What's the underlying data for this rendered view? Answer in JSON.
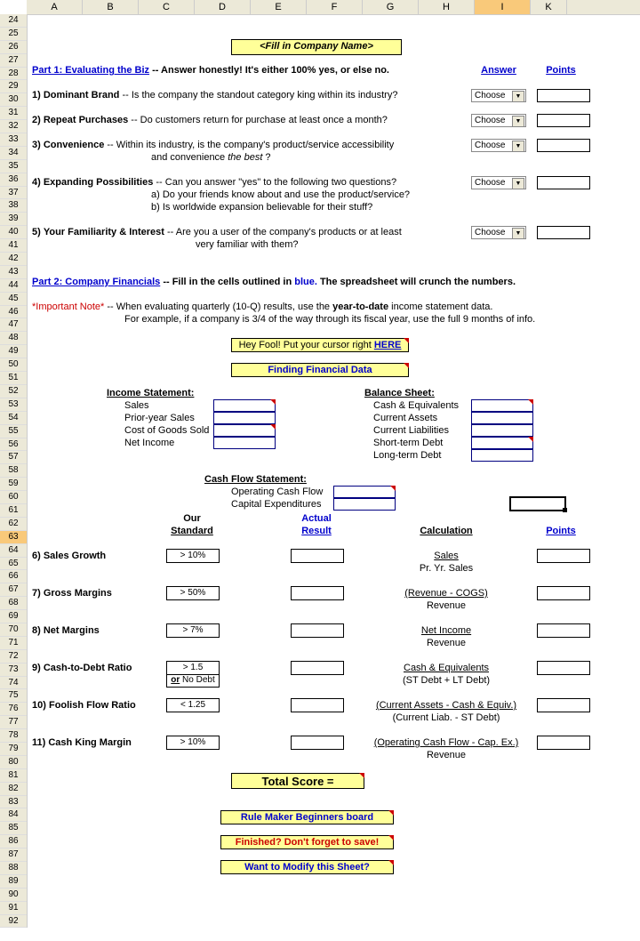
{
  "cols": [
    "A",
    "B",
    "C",
    "D",
    "E",
    "F",
    "G",
    "H",
    "I",
    "K"
  ],
  "selected_col": "I",
  "row_start": 24,
  "row_end": 92,
  "selected_row": 63,
  "title": "<Fill in Company Name>",
  "part1": {
    "heading": "Part 1:  Evaluating the Biz",
    "suffix": " -- Answer honestly!  It's either 100% yes, or else no.",
    "answer_hdr": "Answer",
    "points_hdr": "Points"
  },
  "q": [
    {
      "n": "1)",
      "label": "Dominant Brand",
      "text": " -- Is the company the standout category king within its industry?",
      "choose": "Choose"
    },
    {
      "n": "2)",
      "label": "Repeat Purchases",
      "text": " -- Do customers return for purchase at least once a month?",
      "choose": "Choose"
    },
    {
      "n": "3)",
      "label": "Convenience",
      "text": " -- Within its industry, is the company's product/service accessibility",
      "sub": "and convenience the best ?",
      "choose": "Choose"
    },
    {
      "n": "4)",
      "label": "Expanding Possibilities",
      "text": " -- Can you answer \"yes\" to the following two questions?",
      "sub1": "a) Do your friends know about and use the product/service?",
      "sub2": "b) Is worldwide expansion believable for their stuff?",
      "choose": "Choose"
    },
    {
      "n": "5)",
      "label": "Your Familiarity & Interest",
      "text": " -- Are you a user of the company's products or at least",
      "sub": "very familiar with them?",
      "choose": "Choose"
    }
  ],
  "part2": {
    "heading": "Part 2:  Company Financials",
    "suffix": " -- Fill in the cells outlined in ",
    "blue": "blue.",
    "suffix2": " The spreadsheet will crunch the numbers."
  },
  "note": {
    "star": "*Important Note*",
    "text1": " -- When evaluating quarterly (10-Q) results, use the ",
    "bold1": "year-to-date",
    "text2": " income statement data.",
    "line2": "For example, if a company is 3/4 of the way through its fiscal year, use the full 9 months of info."
  },
  "heyfool": {
    "pre": "Hey Fool!  Put your cursor right ",
    "here": "HERE"
  },
  "finding": "Finding Financial Data",
  "income": {
    "hdr": "Income Statement:",
    "rows": [
      "Sales",
      "Prior-year Sales",
      "Cost of Goods Sold",
      "Net Income"
    ]
  },
  "balance": {
    "hdr": "Balance Sheet:",
    "rows": [
      "Cash & Equivalents",
      "Current Assets",
      "Current Liabilities",
      "Short-term Debt",
      "Long-term Debt"
    ]
  },
  "cashflow": {
    "hdr": "Cash Flow Statement:",
    "rows": [
      "Operating Cash Flow",
      "Capital Expenditures"
    ]
  },
  "hdrs": {
    "our1": "Our",
    "our2": "Standard",
    "act1": "Actual",
    "act2": "Result",
    "calc": "Calculation",
    "pts": "Points"
  },
  "m": [
    {
      "n": "6)",
      "label": "Sales Growth",
      "std": "> 10%",
      "c1": "Sales",
      "c2": "Pr. Yr. Sales"
    },
    {
      "n": "7)",
      "label": "Gross Margins",
      "std": "> 50%",
      "c1": "(Revenue - COGS)",
      "c2": "Revenue"
    },
    {
      "n": "8)",
      "label": "Net Margins",
      "std": "> 7%",
      "c1": "Net Income",
      "c2": "Revenue"
    },
    {
      "n": "9)",
      "label": "Cash-to-Debt Ratio",
      "std": "> 1.5",
      "std2": "or No Debt",
      "c1": "Cash & Equivalents",
      "c2": "(ST Debt + LT Debt)"
    },
    {
      "n": "10)",
      "label": "Foolish Flow Ratio",
      "std": "< 1.25",
      "c1": "(Current Assets - Cash & Equiv.)",
      "c2": "(Current Liab. - ST Debt)"
    },
    {
      "n": "11)",
      "label": "Cash King Margin",
      "std": "> 10%",
      "c1": "(Operating Cash Flow - Cap. Ex.)",
      "c2": "Revenue"
    }
  ],
  "total": "Total Score =",
  "footers": [
    "Rule Maker Beginners board",
    "Finished?  Don't forget to save!",
    "Want to Modify this Sheet?"
  ]
}
